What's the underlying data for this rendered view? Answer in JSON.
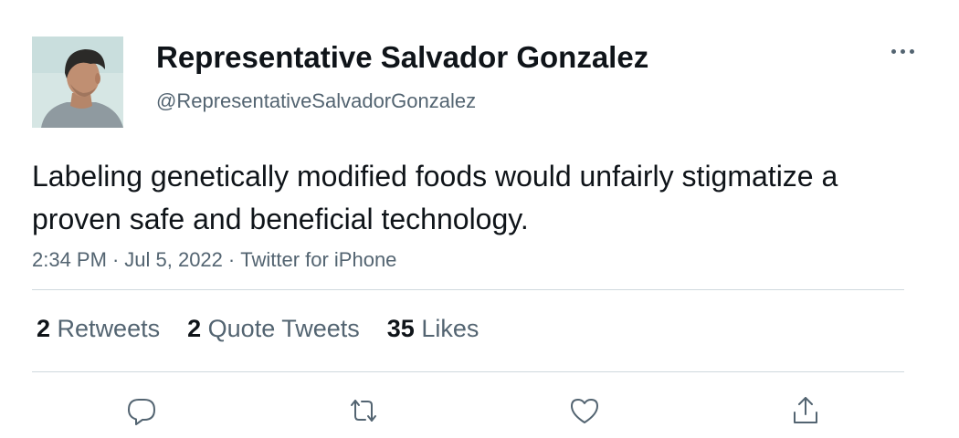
{
  "author": {
    "display_name": "Representative Salvador Gonzalez",
    "handle": "@RepresentativeSalvadorGonzalez"
  },
  "tweet": {
    "text": "Labeling genetically modified foods would unfairly stigmatize a proven safe and beneficial technology.",
    "time": "2:34 PM",
    "date": "Jul 5, 2022",
    "source": "Twitter for iPhone",
    "separator": "·"
  },
  "stats": {
    "retweets_count": "2",
    "retweets_label": "Retweets",
    "quotes_count": "2",
    "quotes_label": "Quote Tweets",
    "likes_count": "35",
    "likes_label": "Likes"
  },
  "actions": {
    "reply_icon": "reply-icon",
    "retweet_icon": "retweet-icon",
    "like_icon": "heart-icon",
    "share_icon": "share-icon"
  },
  "colors": {
    "text_primary": "#0f1419",
    "text_secondary": "#536471",
    "divider": "#cfd9de"
  }
}
